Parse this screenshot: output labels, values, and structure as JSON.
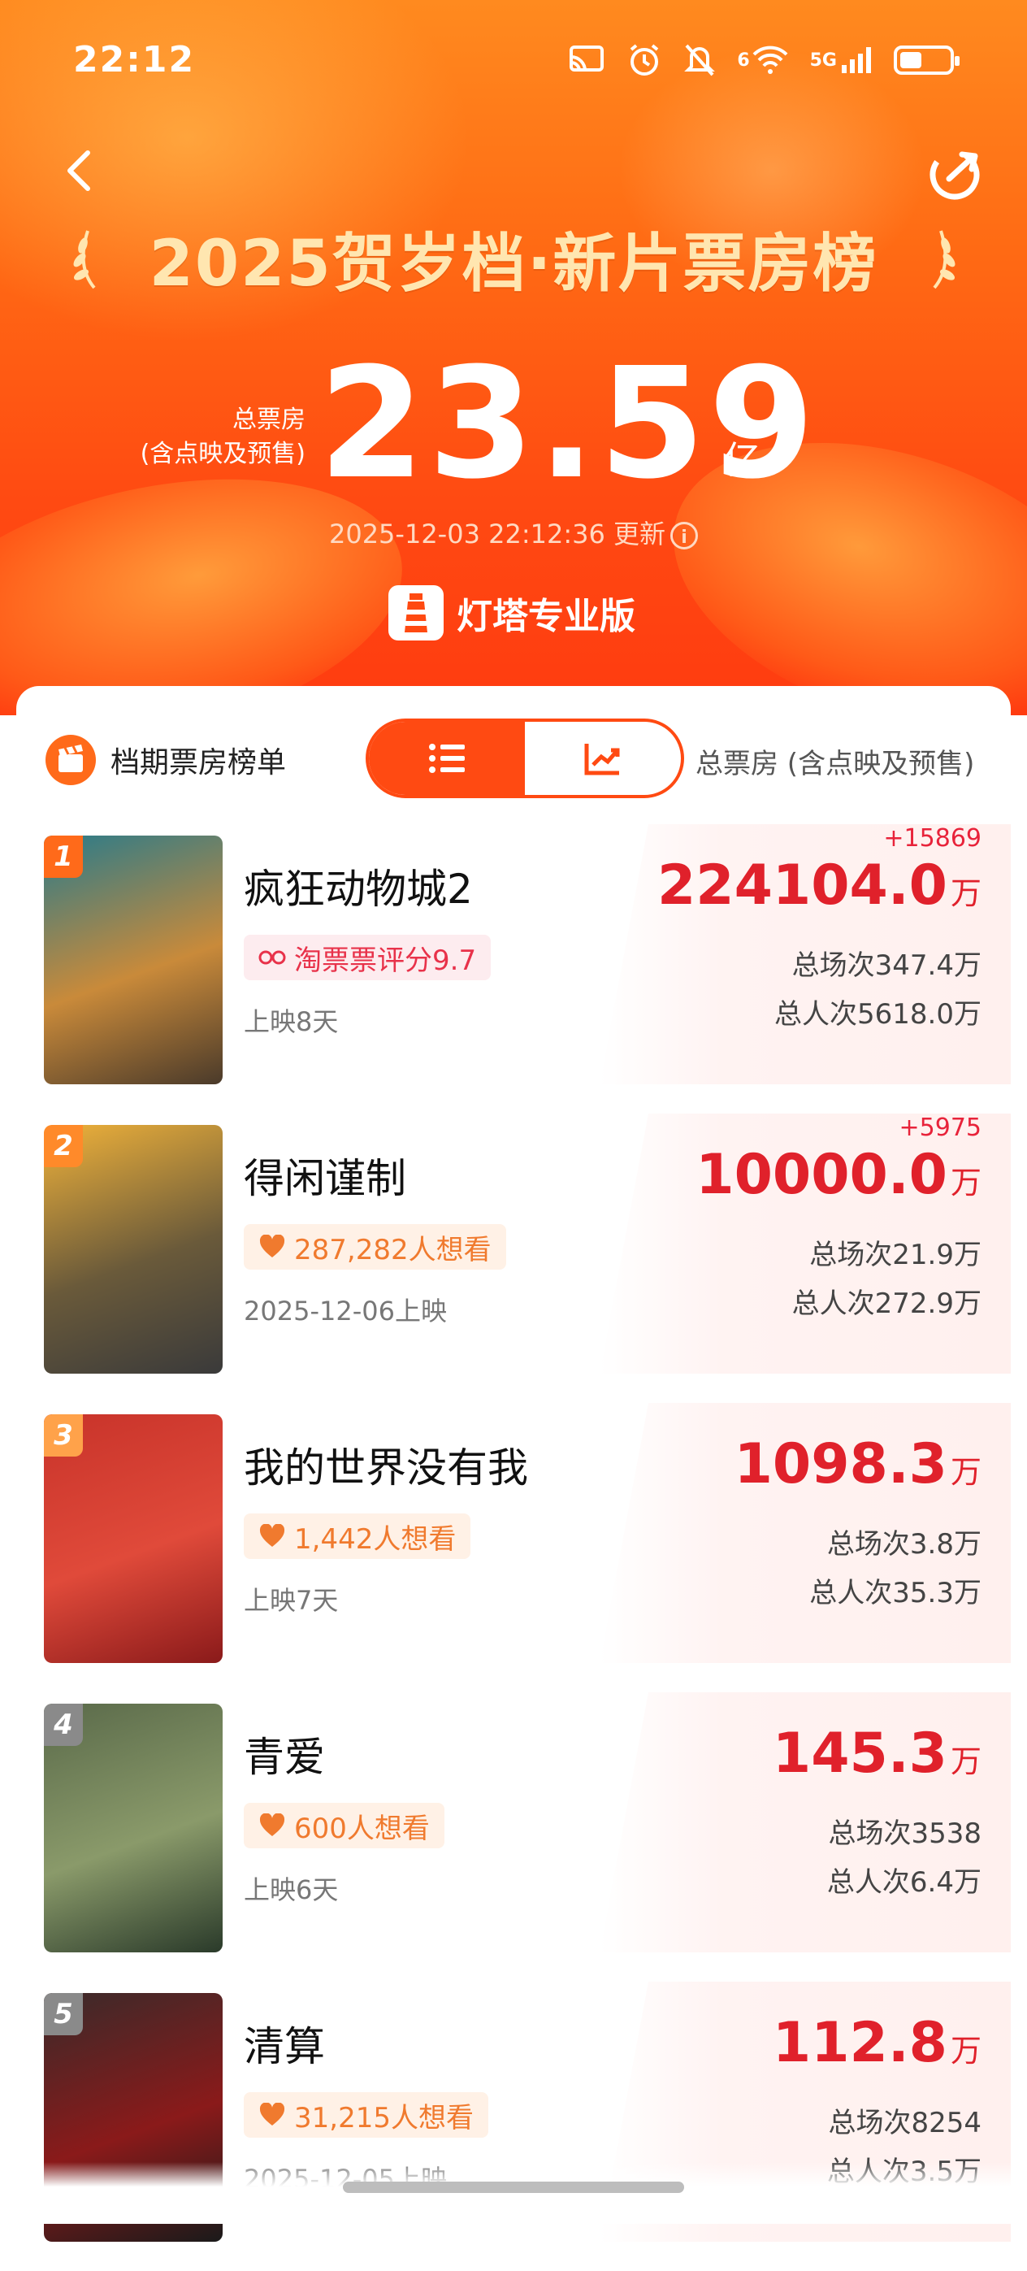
{
  "status_bar": {
    "time": "22:12",
    "network": "5G",
    "signal_label": "6",
    "battery_level": 0.45
  },
  "header": {
    "title": "2025贺岁档·新片票房榜",
    "total_label_line1": "总票房",
    "total_label_line2": "(含点映及预售)",
    "total_value": "23.59",
    "total_unit": "亿",
    "updated_text": "2025-12-03 22:12:36 更新",
    "brand_name": "灯塔专业版"
  },
  "section": {
    "title": "档期票房榜单",
    "caption": "总票房 (含点映及预售)",
    "active_view": "list"
  },
  "movies": [
    {
      "rank": "1",
      "title": "疯狂动物城2",
      "tag_type": "rate",
      "tag_text": "淘票票评分9.7",
      "sub": "上映8天",
      "delta": "+15869",
      "gross": "224104.0",
      "gross_unit": "万",
      "sessions": "总场次347.4万",
      "viewers": "总人次5618.0万",
      "rank_color": "#ff6a1a",
      "poster_colors": [
        "#2a7b8a",
        "#c98a3a",
        "#4a3a2a"
      ]
    },
    {
      "rank": "2",
      "title": "得闲谨制",
      "tag_type": "want",
      "tag_text": "287,282人想看",
      "sub": "2025-12-06上映",
      "delta": "+5975",
      "gross": "10000.0",
      "gross_unit": "万",
      "sessions": "总场次21.9万",
      "viewers": "总人次272.9万",
      "rank_color": "#ff8a2a",
      "poster_colors": [
        "#f0b23a",
        "#6a5a3a",
        "#3a3a3a"
      ]
    },
    {
      "rank": "3",
      "title": "我的世界没有我",
      "tag_type": "want",
      "tag_text": "1,442人想看",
      "sub": "上映7天",
      "delta": "",
      "gross": "1098.3",
      "gross_unit": "万",
      "sessions": "总场次3.8万",
      "viewers": "总人次35.3万",
      "rank_color": "#ffa24a",
      "poster_colors": [
        "#c8332a",
        "#e04a3a",
        "#8a1a1a"
      ]
    },
    {
      "rank": "4",
      "title": "青爱",
      "tag_type": "want",
      "tag_text": "600人想看",
      "sub": "上映6天",
      "delta": "",
      "gross": "145.3",
      "gross_unit": "万",
      "sessions": "总场次3538",
      "viewers": "总人次6.4万",
      "rank_color": "#8a8a8a",
      "poster_colors": [
        "#5a6a4a",
        "#8a9a6a",
        "#2a3a2a"
      ]
    },
    {
      "rank": "5",
      "title": "清算",
      "tag_type": "want",
      "tag_text": "31,215人想看",
      "sub": "2025-12-05上映",
      "delta": "",
      "gross": "112.8",
      "gross_unit": "万",
      "sessions": "总场次8254",
      "viewers": "总人次3.5万",
      "rank_color": "#8a8a8a",
      "poster_colors": [
        "#3a2a2a",
        "#8a1a1a",
        "#1a1a1a"
      ]
    }
  ]
}
